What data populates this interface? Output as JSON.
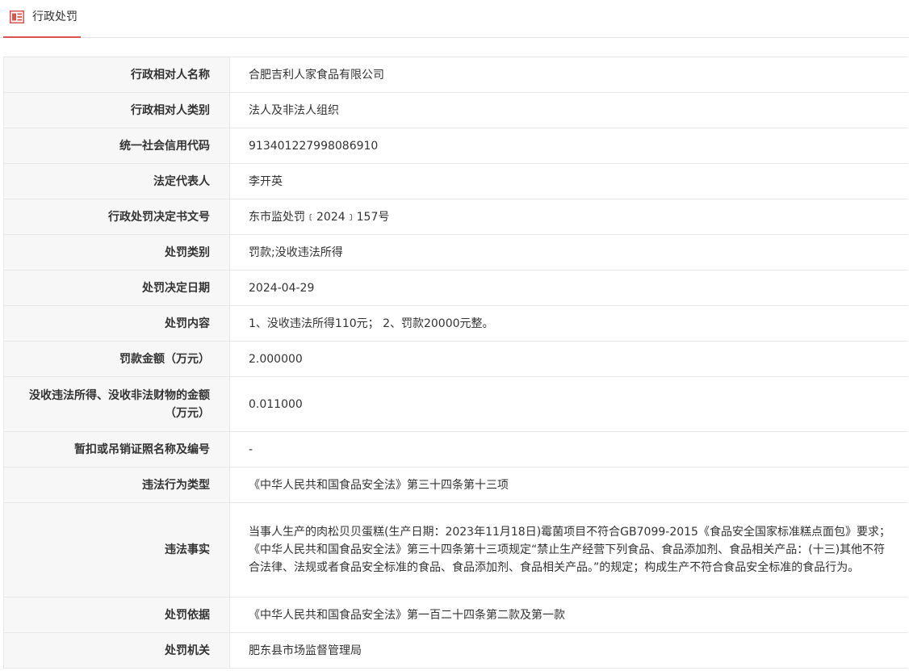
{
  "header": {
    "title": "行政处罚",
    "icon": "news-list-icon",
    "accent_color": "#d9534f"
  },
  "rows": [
    {
      "label": "行政相对人名称",
      "value": "合肥吉利人家食品有限公司"
    },
    {
      "label": "行政相对人类别",
      "value": "法人及非法人组织"
    },
    {
      "label": "统一社会信用代码",
      "value": "913401227998086910"
    },
    {
      "label": "法定代表人",
      "value": "李开英"
    },
    {
      "label": "行政处罚决定书文号",
      "value": "东市监处罚﹝2024﹞157号"
    },
    {
      "label": "处罚类别",
      "value": "罚款;没收违法所得"
    },
    {
      "label": "处罚决定日期",
      "value": "2024-04-29"
    },
    {
      "label": "处罚内容",
      "value": "1、没收违法所得110元； 2、罚款20000元整。"
    },
    {
      "label": "罚款金额（万元）",
      "value": "2.000000"
    },
    {
      "label": "没收违法所得、没收非法财物的金额（万元）",
      "value": "0.011000"
    },
    {
      "label": "暂扣或吊销证照名称及编号",
      "value": "-"
    },
    {
      "label": "违法行为类型",
      "value": "《中华人民共和国食品安全法》第三十四条第十三项"
    },
    {
      "label": "违法事实",
      "value": "当事人生产的肉松贝贝蛋糕(生产日期：2023年11月18日)霉菌项目不符合GB7099-2015《食品安全国家标准糕点面包》要求；《中华人民共和国食品安全法》第三十四条第十三项规定“禁止生产经营下列食品、食品添加剂、食品相关产品：(十三)其他不符合法律、法规或者食品安全标准的食品、食品添加剂、食品相关产品。”的规定；构成生产不符合食品安全标准的食品行为。"
    },
    {
      "label": "处罚依据",
      "value": "《中华人民共和国食品安全法》第一百二十四条第二款及第一款"
    },
    {
      "label": "处罚机关",
      "value": "肥东县市场监督管理局"
    }
  ]
}
